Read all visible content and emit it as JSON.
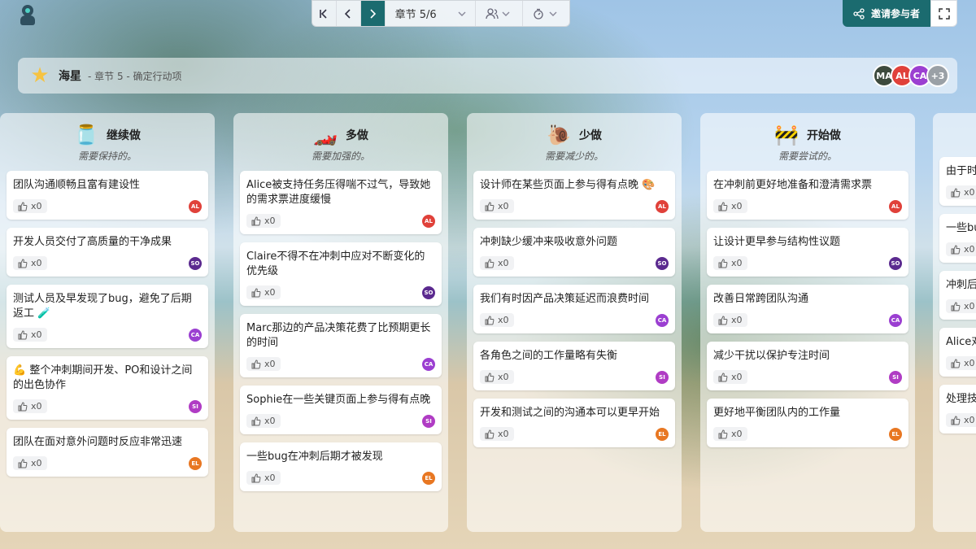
{
  "navbar": {
    "section_label": "章节 5/6"
  },
  "header": {
    "title": "海星",
    "subtitle": "- 章节 5 - 确定行动项",
    "invite_label": "邀请参与者"
  },
  "participants": [
    {
      "initials": "MA",
      "color": "#3d4a3d"
    },
    {
      "initials": "AL",
      "color": "#e0413a"
    },
    {
      "initials": "CA",
      "color": "#9b3fd1"
    },
    {
      "initials": "+3",
      "color": "#9aa0a6"
    }
  ],
  "columns": [
    {
      "icon": "🫙",
      "title": "继续做",
      "subtitle": "需要保持的。",
      "cards": [
        {
          "text": "团队沟通顺畅且富有建设性",
          "votes": "x0",
          "author": "AL",
          "color": "#e0413a"
        },
        {
          "text": "开发人员交付了高质量的干净成果",
          "votes": "x0",
          "author": "SO",
          "color": "#5b2a8f"
        },
        {
          "text": "测试人员及早发现了bug，避免了后期返工 🧪",
          "votes": "x0",
          "author": "CA",
          "color": "#9b3fd1"
        },
        {
          "text": "💪 整个冲刺期间开发、PO和设计之间的出色协作",
          "votes": "x0",
          "author": "SI",
          "color": "#b03cc4"
        },
        {
          "text": "团队在面对意外问题时反应非常迅速",
          "votes": "x0",
          "author": "EL",
          "color": "#e87722"
        }
      ]
    },
    {
      "icon": "🏎️",
      "title": "多做",
      "subtitle": "需要加强的。",
      "cards": [
        {
          "text": "Alice被支持任务压得喘不过气，导致她的需求票进度缓慢",
          "votes": "x0",
          "author": "AL",
          "color": "#e0413a"
        },
        {
          "text": "Claire不得不在冲刺中应对不断变化的优先级",
          "votes": "x0",
          "author": "SO",
          "color": "#5b2a8f"
        },
        {
          "text": "Marc那边的产品决策花费了比预期更长的时间",
          "votes": "x0",
          "author": "CA",
          "color": "#9b3fd1"
        },
        {
          "text": "Sophie在一些关键页面上参与得有点晚",
          "votes": "x0",
          "author": "SI",
          "color": "#b03cc4"
        },
        {
          "text": "一些bug在冲刺后期才被发现",
          "votes": "x0",
          "author": "EL",
          "color": "#e87722"
        }
      ]
    },
    {
      "icon": "🐌",
      "title": "少做",
      "subtitle": "需要减少的。",
      "cards": [
        {
          "text": "设计师在某些页面上参与得有点晚 🎨",
          "votes": "x0",
          "author": "AL",
          "color": "#e0413a"
        },
        {
          "text": "冲刺缺少缓冲来吸收意外问题",
          "votes": "x0",
          "author": "SO",
          "color": "#5b2a8f"
        },
        {
          "text": "我们有时因产品决策延迟而浪费时间",
          "votes": "x0",
          "author": "CA",
          "color": "#9b3fd1"
        },
        {
          "text": "各角色之间的工作量略有失衡",
          "votes": "x0",
          "author": "SI",
          "color": "#b03cc4"
        },
        {
          "text": "开发和测试之间的沟通本可以更早开始",
          "votes": "x0",
          "author": "EL",
          "color": "#e87722"
        }
      ]
    },
    {
      "icon": "🚧",
      "title": "开始做",
      "subtitle": "需要尝试的。",
      "cards": [
        {
          "text": "在冲刺前更好地准备和澄清需求票",
          "votes": "x0",
          "author": "AL",
          "color": "#e0413a"
        },
        {
          "text": "让设计更早参与结构性议题",
          "votes": "x0",
          "author": "SO",
          "color": "#5b2a8f"
        },
        {
          "text": "改善日常跨团队沟通",
          "votes": "x0",
          "author": "CA",
          "color": "#9b3fd1"
        },
        {
          "text": "减少干扰以保护专注时间",
          "votes": "x0",
          "author": "SI",
          "color": "#b03cc4"
        },
        {
          "text": "更好地平衡团队内的工作量",
          "votes": "x0",
          "author": "EL",
          "color": "#e87722"
        }
      ]
    },
    {
      "icon": "",
      "title": "",
      "subtitle": "",
      "cards": [
        {
          "text": "由于时",
          "votes": "x0",
          "author": "",
          "color": "#e0413a"
        },
        {
          "text": "一些bu",
          "votes": "x0",
          "author": "",
          "color": "#5b2a8f"
        },
        {
          "text": "冲刺后",
          "votes": "x0",
          "author": "",
          "color": "#9b3fd1"
        },
        {
          "text": "Alice对",
          "votes": "x0",
          "author": "",
          "color": "#b03cc4"
        },
        {
          "text": "处理技",
          "votes": "x0",
          "author": "",
          "color": "#e87722"
        }
      ]
    }
  ]
}
